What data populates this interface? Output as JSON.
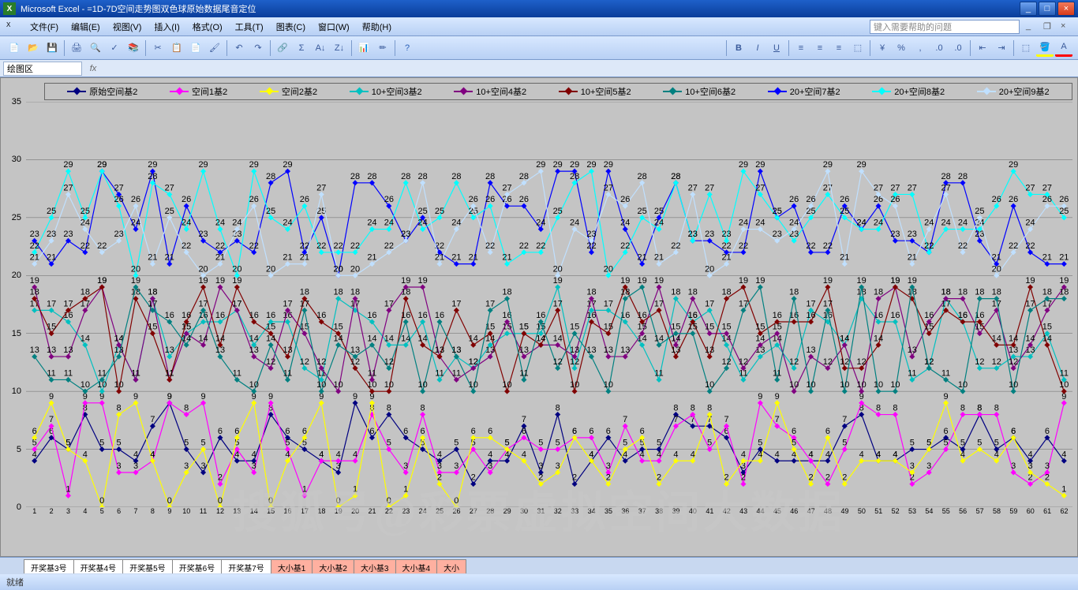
{
  "window": {
    "title": "Microsoft Excel - =1D-7D空间走势图双色球原始数据尾音定位"
  },
  "menu": {
    "file": "文件(F)",
    "edit": "编辑(E)",
    "view": "视图(V)",
    "insert": "插入(I)",
    "format": "格式(O)",
    "tools": "工具(T)",
    "chart": "图表(C)",
    "window": "窗口(W)",
    "help": "帮助(H)",
    "question_placeholder": "键入需要帮助的问题"
  },
  "formula": {
    "name": "绘图区",
    "fx": "fx"
  },
  "legend": [
    {
      "label": "原始空间基2",
      "color": "#000080"
    },
    {
      "label": "空间1基2",
      "color": "#ff00ff"
    },
    {
      "label": "空间2基2",
      "color": "#ffff00"
    },
    {
      "label": "10+空间3基2",
      "color": "#00c0c0"
    },
    {
      "label": "10+空间4基2",
      "color": "#800080"
    },
    {
      "label": "10+空间5基2",
      "color": "#800000"
    },
    {
      "label": "10+空间6基2",
      "color": "#008080"
    },
    {
      "label": "20+空间7基2",
      "color": "#0000ff"
    },
    {
      "label": "20+空间8基2",
      "color": "#00ffff"
    },
    {
      "label": "20+空间9基2",
      "color": "#c0e0ff"
    }
  ],
  "tabs": {
    "sheets": [
      "开奖基3号",
      "开奖基4号",
      "开奖基5号",
      "开奖基6号",
      "开奖基7号"
    ],
    "big_sheets": [
      "大小基1",
      "大小基2",
      "大小基3",
      "大小基4",
      "大小"
    ]
  },
  "status": "就绪",
  "watermark": "搜狐号@彩票虚拟空间大数据",
  "chart_data": {
    "type": "line",
    "xlabel": "",
    "ylabel": "",
    "ylim": [
      0,
      35
    ],
    "yticks": [
      0,
      5,
      10,
      15,
      20,
      25,
      30,
      35
    ],
    "x": [
      1,
      2,
      3,
      4,
      5,
      6,
      7,
      8,
      9,
      10,
      11,
      12,
      13,
      14,
      15,
      16,
      17,
      18,
      19,
      20,
      21,
      22,
      23,
      24,
      25,
      26,
      27,
      28,
      29,
      30,
      31,
      32,
      33,
      34,
      35,
      36,
      37,
      38,
      39,
      40,
      41,
      42,
      43,
      44,
      45,
      46,
      47,
      48,
      49,
      50,
      51,
      52,
      53,
      54,
      55,
      56,
      57,
      58,
      59,
      60,
      61,
      62
    ],
    "series": [
      {
        "name": "原始空间基2",
        "color": "#000080",
        "values": [
          4,
          6,
          5,
          8,
          5,
          5,
          4,
          7,
          9,
          5,
          3,
          6,
          4,
          4,
          8,
          6,
          5,
          4,
          3,
          9,
          6,
          8,
          6,
          5,
          4,
          5,
          2,
          4,
          4,
          7,
          3,
          8,
          2,
          4,
          6,
          4,
          5,
          5,
          8,
          7,
          7,
          6,
          3,
          5,
          4,
          4,
          4,
          4,
          7,
          8,
          4,
          4,
          5,
          5,
          6,
          5,
          8,
          5,
          6,
          4,
          6,
          4
        ]
      },
      {
        "name": "空间1基2",
        "color": "#ff00ff",
        "values": [
          5,
          7,
          1,
          9,
          9,
          3,
          3,
          4,
          9,
          8,
          9,
          2,
          5,
          3,
          9,
          5,
          1,
          4,
          4,
          4,
          8,
          5,
          3,
          8,
          3,
          3,
          5,
          3,
          5,
          6,
          5,
          5,
          6,
          6,
          3,
          7,
          4,
          4,
          7,
          8,
          5,
          7,
          2,
          9,
          7,
          6,
          4,
          2,
          5,
          9,
          8,
          8,
          2,
          3,
          5,
          8,
          8,
          8,
          3,
          2,
          3,
          9
        ]
      },
      {
        "name": "空间2基2",
        "color": "#ffff00",
        "values": [
          6,
          9,
          5,
          4,
          0,
          8,
          9,
          4,
          0,
          3,
          5,
          0,
          6,
          9,
          0,
          4,
          6,
          9,
          0,
          1,
          9,
          0,
          1,
          6,
          2,
          0,
          6,
          6,
          5,
          4,
          2,
          3,
          6,
          4,
          2,
          5,
          6,
          2,
          4,
          4,
          8,
          2,
          4,
          4,
          9,
          5,
          2,
          6,
          2,
          4,
          4,
          4,
          3,
          5,
          9,
          4,
          5,
          4,
          6,
          3,
          2,
          1
        ]
      },
      {
        "name": "10+空间3基2",
        "color": "#00c0c0",
        "values": [
          17,
          17,
          16,
          14,
          10,
          14,
          11,
          18,
          13,
          15,
          16,
          16,
          17,
          14,
          16,
          16,
          12,
          11,
          18,
          17,
          16,
          14,
          14,
          16,
          11,
          13,
          12,
          14,
          15,
          15,
          15,
          19,
          12,
          17,
          17,
          16,
          14,
          11,
          18,
          16,
          17,
          14,
          11,
          13,
          14,
          12,
          17,
          16,
          14,
          18,
          16,
          16,
          11,
          12,
          18,
          16,
          12,
          12,
          13,
          13,
          15,
          11
        ]
      },
      {
        "name": "10+空间4基2",
        "color": "#800080",
        "values": [
          19,
          13,
          13,
          17,
          19,
          14,
          11,
          18,
          11,
          15,
          14,
          19,
          17,
          13,
          12,
          17,
          15,
          12,
          10,
          18,
          11,
          17,
          19,
          19,
          13,
          11,
          12,
          13,
          16,
          13,
          14,
          14,
          13,
          18,
          13,
          13,
          15,
          19,
          14,
          18,
          15,
          15,
          12,
          14,
          15,
          10,
          13,
          12,
          14,
          10,
          18,
          19,
          13,
          16,
          18,
          18,
          15,
          17,
          12,
          14,
          17,
          19
        ]
      },
      {
        "name": "10+空间5基2",
        "color": "#800000",
        "values": [
          18,
          15,
          17,
          18,
          19,
          10,
          18,
          15,
          11,
          16,
          19,
          14,
          19,
          16,
          15,
          13,
          18,
          16,
          15,
          12,
          10,
          10,
          18,
          14,
          13,
          17,
          14,
          15,
          10,
          15,
          14,
          17,
          10,
          16,
          15,
          19,
          16,
          17,
          13,
          16,
          13,
          18,
          19,
          15,
          16,
          16,
          16,
          19,
          12,
          12,
          14,
          19,
          18,
          15,
          17,
          16,
          16,
          14,
          14,
          19,
          14,
          10
        ]
      },
      {
        "name": "10+空间6基2",
        "color": "#008080",
        "values": [
          13,
          11,
          11,
          10,
          11,
          13,
          19,
          17,
          16,
          14,
          17,
          13,
          11,
          10,
          14,
          11,
          17,
          10,
          14,
          13,
          14,
          12,
          16,
          10,
          16,
          13,
          10,
          17,
          18,
          11,
          16,
          12,
          15,
          13,
          10,
          18,
          19,
          14,
          15,
          15,
          10,
          12,
          17,
          19,
          11,
          18,
          10,
          17,
          10,
          19,
          10,
          10,
          19,
          12,
          11,
          10,
          18,
          18,
          10,
          17,
          18,
          18
        ]
      },
      {
        "name": "20+空间7基2",
        "color": "#0000ff",
        "values": [
          23,
          21,
          23,
          22,
          29,
          27,
          24,
          29,
          21,
          26,
          23,
          22,
          23,
          22,
          28,
          29,
          22,
          25,
          20,
          28,
          28,
          26,
          23,
          25,
          22,
          21,
          21,
          28,
          26,
          26,
          24,
          29,
          29,
          22,
          29,
          24,
          21,
          25,
          28,
          23,
          23,
          22,
          22,
          29,
          25,
          26,
          22,
          22,
          26,
          24,
          26,
          23,
          23,
          22,
          28,
          28,
          23,
          21,
          26,
          22,
          21,
          21
        ]
      },
      {
        "name": "20+空间8基2",
        "color": "#00ffff",
        "values": [
          22,
          25,
          29,
          25,
          29,
          26,
          20,
          28,
          27,
          24,
          29,
          24,
          20,
          29,
          25,
          24,
          26,
          22,
          22,
          22,
          24,
          24,
          28,
          24,
          25,
          28,
          25,
          26,
          21,
          22,
          22,
          25,
          28,
          29,
          20,
          22,
          25,
          24,
          28,
          23,
          27,
          23,
          29,
          27,
          25,
          23,
          25,
          27,
          25,
          24,
          24,
          27,
          27,
          22,
          24,
          24,
          24,
          26,
          29,
          27,
          27,
          25
        ]
      },
      {
        "name": "20+空间9基2",
        "color": "#c0e0ff",
        "values": [
          21,
          23,
          27,
          24,
          22,
          23,
          26,
          21,
          25,
          22,
          20,
          21,
          24,
          26,
          20,
          21,
          21,
          27,
          20,
          20,
          21,
          22,
          23,
          28,
          21,
          24,
          26,
          22,
          27,
          28,
          29,
          20,
          24,
          23,
          27,
          26,
          28,
          21,
          22,
          27,
          20,
          21,
          24,
          24,
          23,
          24,
          26,
          29,
          21,
          29,
          27,
          26,
          21,
          24,
          27,
          22,
          25,
          20,
          22,
          24,
          26,
          26
        ]
      }
    ]
  }
}
